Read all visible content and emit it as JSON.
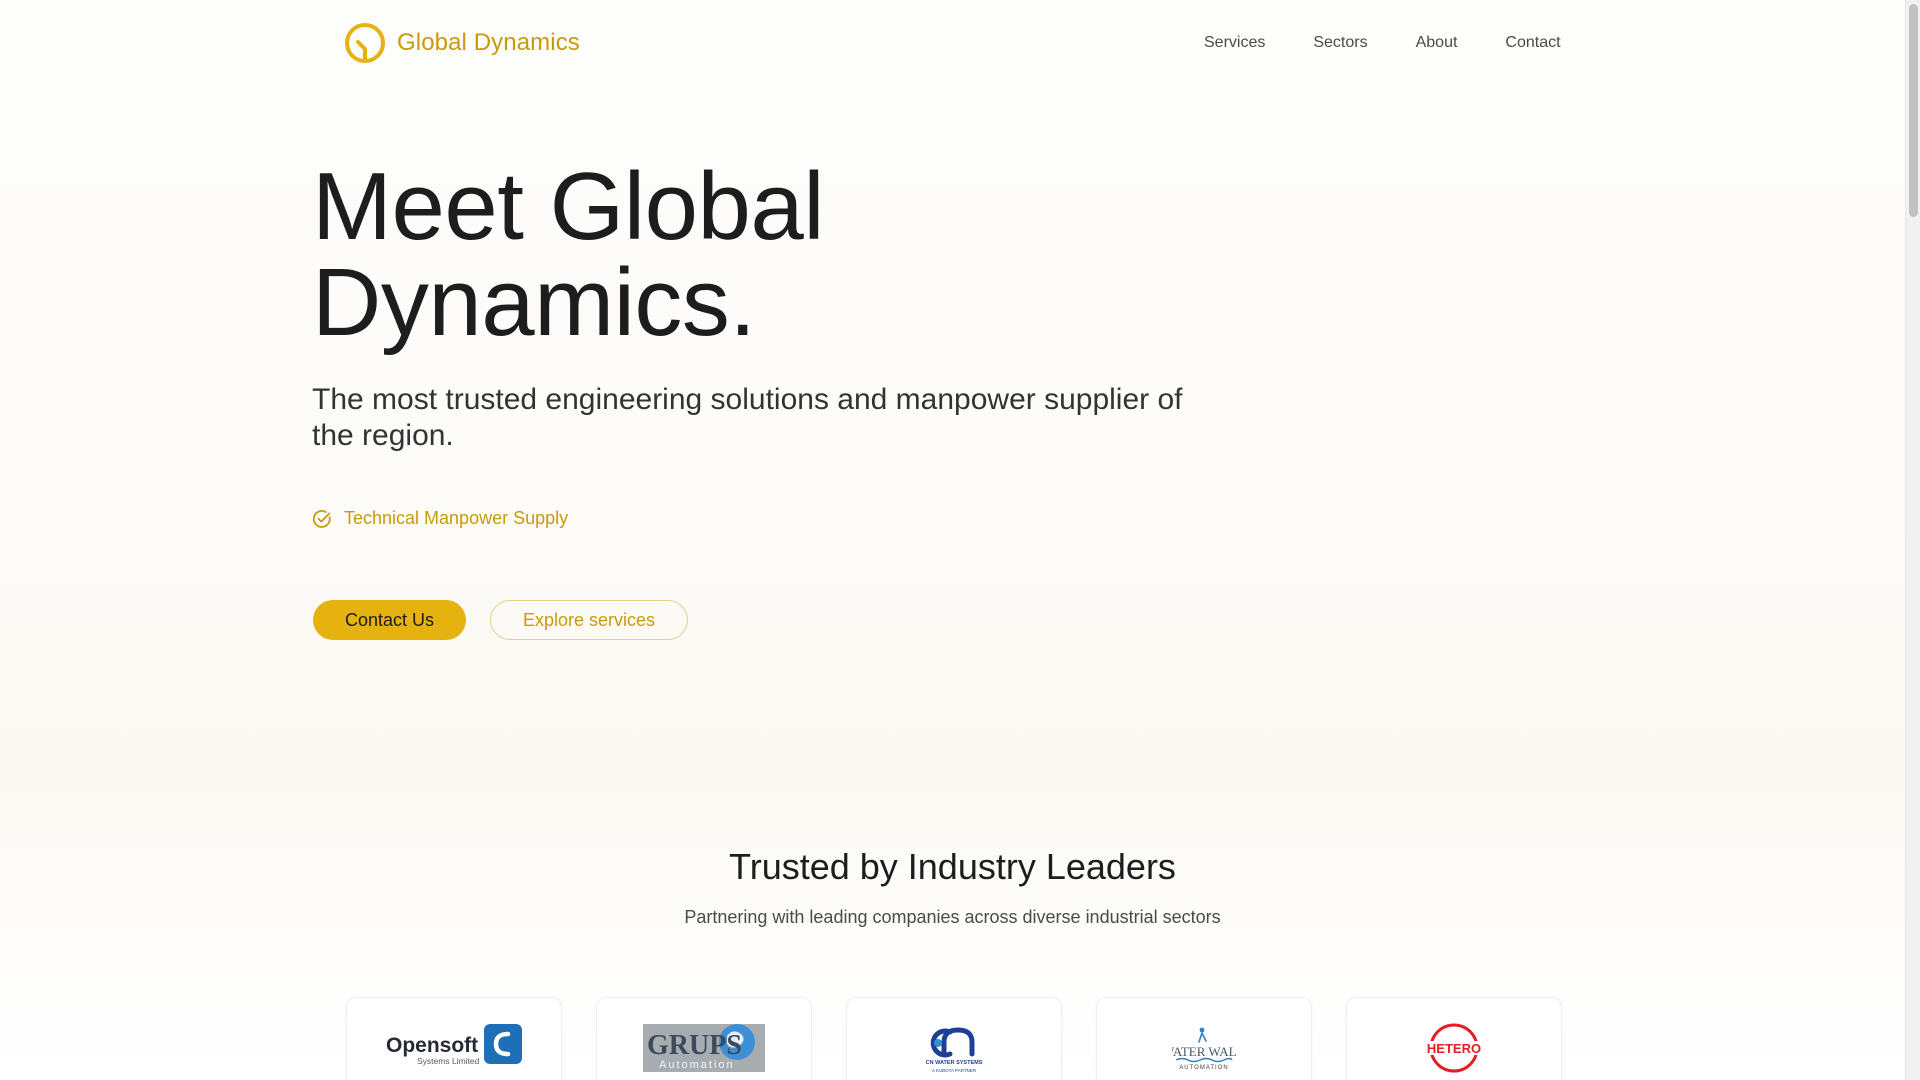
{
  "header": {
    "brand_name": "Global Dynamics",
    "nav": [
      {
        "label": "Services"
      },
      {
        "label": "Sectors"
      },
      {
        "label": "About"
      },
      {
        "label": "Contact"
      }
    ]
  },
  "hero": {
    "title_line1": "Meet Global",
    "title_line2": "Dynamics.",
    "subtitle": "The most trusted engineering solutions and manpower supplier of the region.",
    "feature": "Technical Manpower Supply",
    "primary_button": "Contact Us",
    "secondary_button": "Explore services"
  },
  "trusted": {
    "title": "Trusted by Industry Leaders",
    "subtitle": "Partnering with leading companies across diverse industrial sectors",
    "logos": [
      {
        "name": "Opensoft",
        "tagline": "Systems Limited",
        "icon": "opensoft-logo"
      },
      {
        "name": "GRUPS",
        "tagline": "Automation",
        "icon": "grups-automation-logo"
      },
      {
        "name": "CN WATER SYSTEMS",
        "tagline": "A KUBOTA PARTNER",
        "icon": "cn-water-systems-logo"
      },
      {
        "name": "WATER WALK",
        "tagline": "AUTOMATION",
        "icon": "water-walk-logo"
      },
      {
        "name": "HETERO",
        "tagline": "",
        "icon": "hetero-logo"
      }
    ]
  },
  "colors": {
    "accent": "#c99a0a",
    "primary_button_bg": "#e6b20f",
    "text_dark": "#1d1d1d",
    "hetero_red": "#e31e24",
    "opensoft_blue": "#1e6fb8",
    "cn_blue": "#1f3f94"
  }
}
